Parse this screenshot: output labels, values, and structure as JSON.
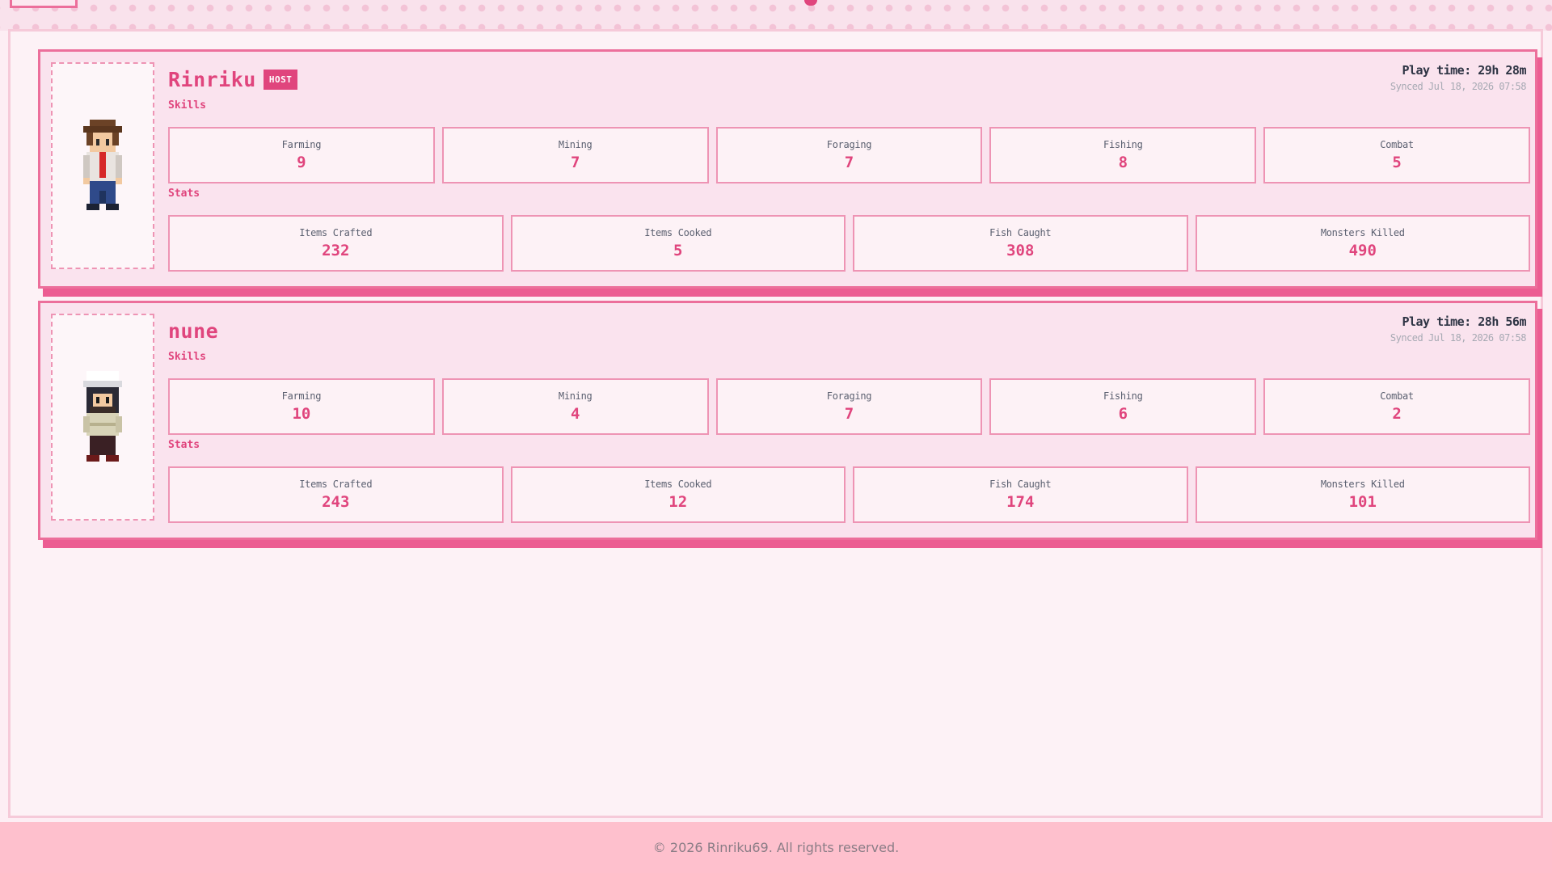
{
  "colors": {
    "accent": "#e0457d",
    "border": "#ec6f9b",
    "card_bg": "#fae3ee",
    "footer_bg": "#fec0cd"
  },
  "skills_label": "Skills",
  "stats_label": "Stats",
  "players": [
    {
      "name": "Rinriku",
      "badge": "HOST",
      "play_time": "Play time: 29h 28m",
      "synced": "Synced Jul 18, 2026 07:58",
      "avatar_icon": "farmer-sprite-brown-hat",
      "skills": [
        {
          "label": "Farming",
          "value": "9"
        },
        {
          "label": "Mining",
          "value": "7"
        },
        {
          "label": "Foraging",
          "value": "7"
        },
        {
          "label": "Fishing",
          "value": "8"
        },
        {
          "label": "Combat",
          "value": "5"
        }
      ],
      "stats": [
        {
          "label": "Items Crafted",
          "value": "232"
        },
        {
          "label": "Items Cooked",
          "value": "5"
        },
        {
          "label": "Fish Caught",
          "value": "308"
        },
        {
          "label": "Monsters Killed",
          "value": "490"
        }
      ]
    },
    {
      "name": "nune",
      "badge": "",
      "play_time": "Play time: 28h 56m",
      "synced": "Synced Jul 18, 2026 07:58",
      "avatar_icon": "farmer-sprite-white-hat",
      "skills": [
        {
          "label": "Farming",
          "value": "10"
        },
        {
          "label": "Mining",
          "value": "4"
        },
        {
          "label": "Foraging",
          "value": "7"
        },
        {
          "label": "Fishing",
          "value": "6"
        },
        {
          "label": "Combat",
          "value": "2"
        }
      ],
      "stats": [
        {
          "label": "Items Crafted",
          "value": "243"
        },
        {
          "label": "Items Cooked",
          "value": "12"
        },
        {
          "label": "Fish Caught",
          "value": "174"
        },
        {
          "label": "Monsters Killed",
          "value": "101"
        }
      ]
    }
  ],
  "footer": {
    "text": "© 2026 Rinriku69. All rights reserved."
  }
}
